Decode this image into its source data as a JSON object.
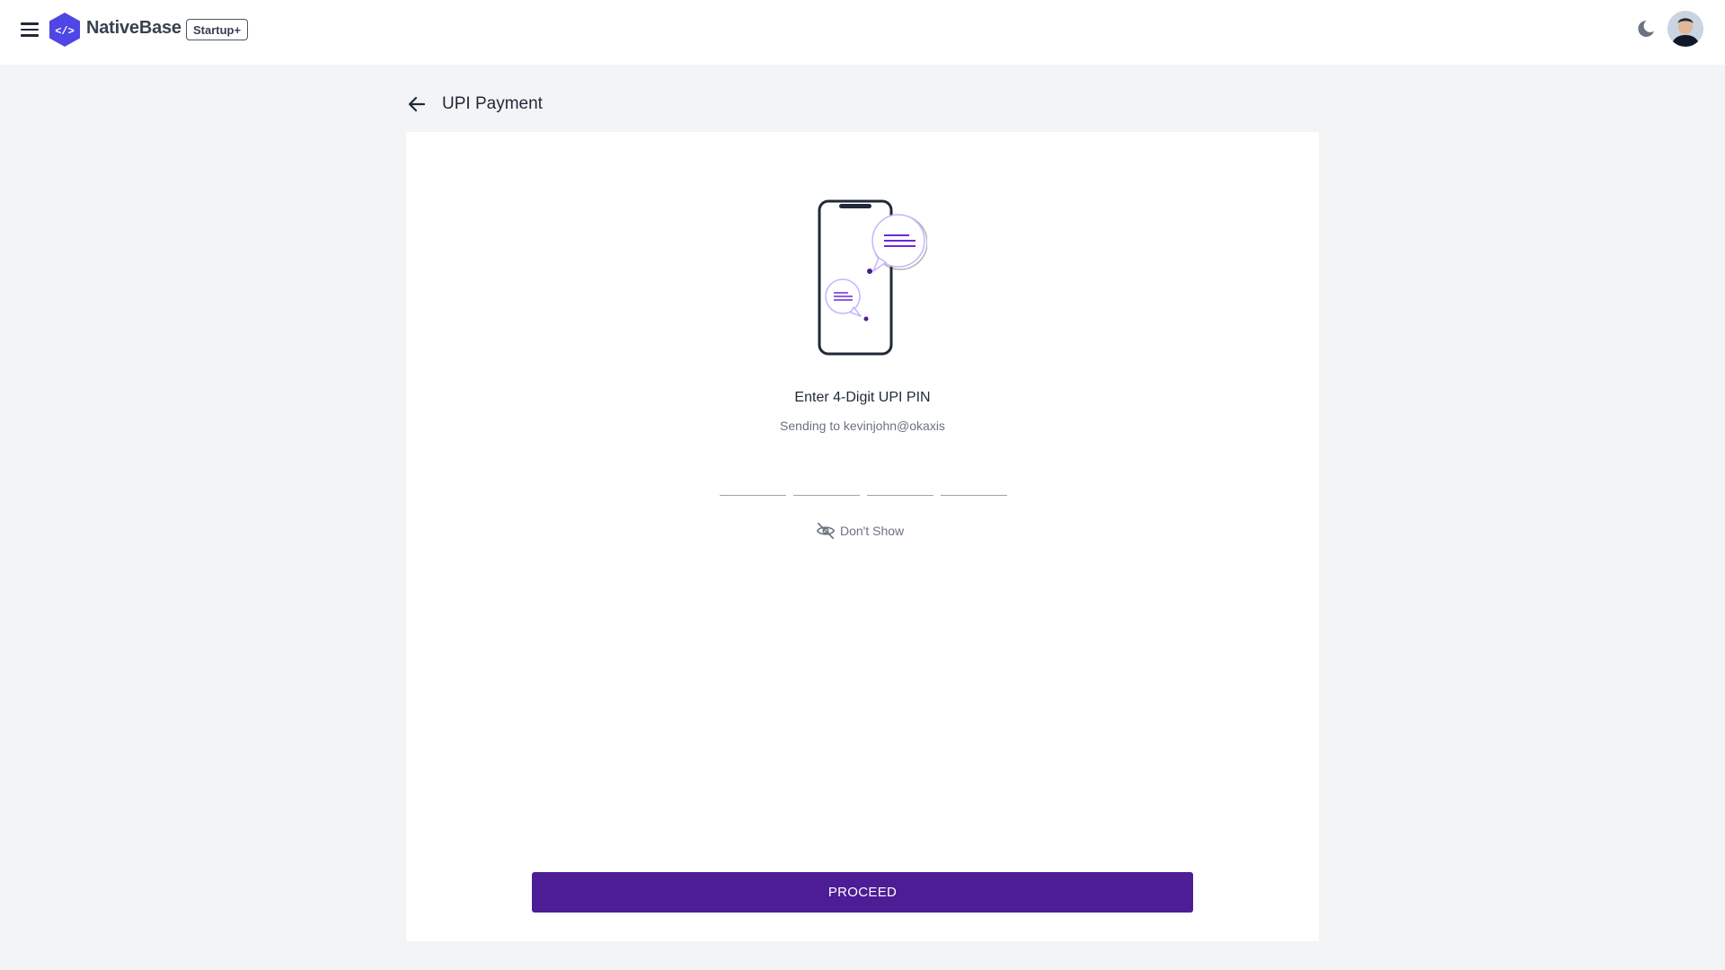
{
  "header": {
    "brand": "NativeBase",
    "plan_badge": "Startup+",
    "menu_icon": "hamburger-menu-icon",
    "theme_icon": "moon-icon",
    "avatar_alt": "User avatar"
  },
  "page": {
    "title": "UPI Payment",
    "back_icon": "arrow-left-icon"
  },
  "pin": {
    "title": "Enter 4-Digit UPI PIN",
    "subtitle": "Sending to kevinjohn@okaxis",
    "digits": [
      "",
      "",
      "",
      ""
    ],
    "toggle_label": "Don't Show",
    "toggle_icon": "eye-off-icon"
  },
  "actions": {
    "proceed_label": "PROCEED"
  },
  "colors": {
    "primary": "#4c1d95",
    "accent": "#6d28d9",
    "background": "#f3f4f6",
    "logo": "#4f46e5"
  }
}
